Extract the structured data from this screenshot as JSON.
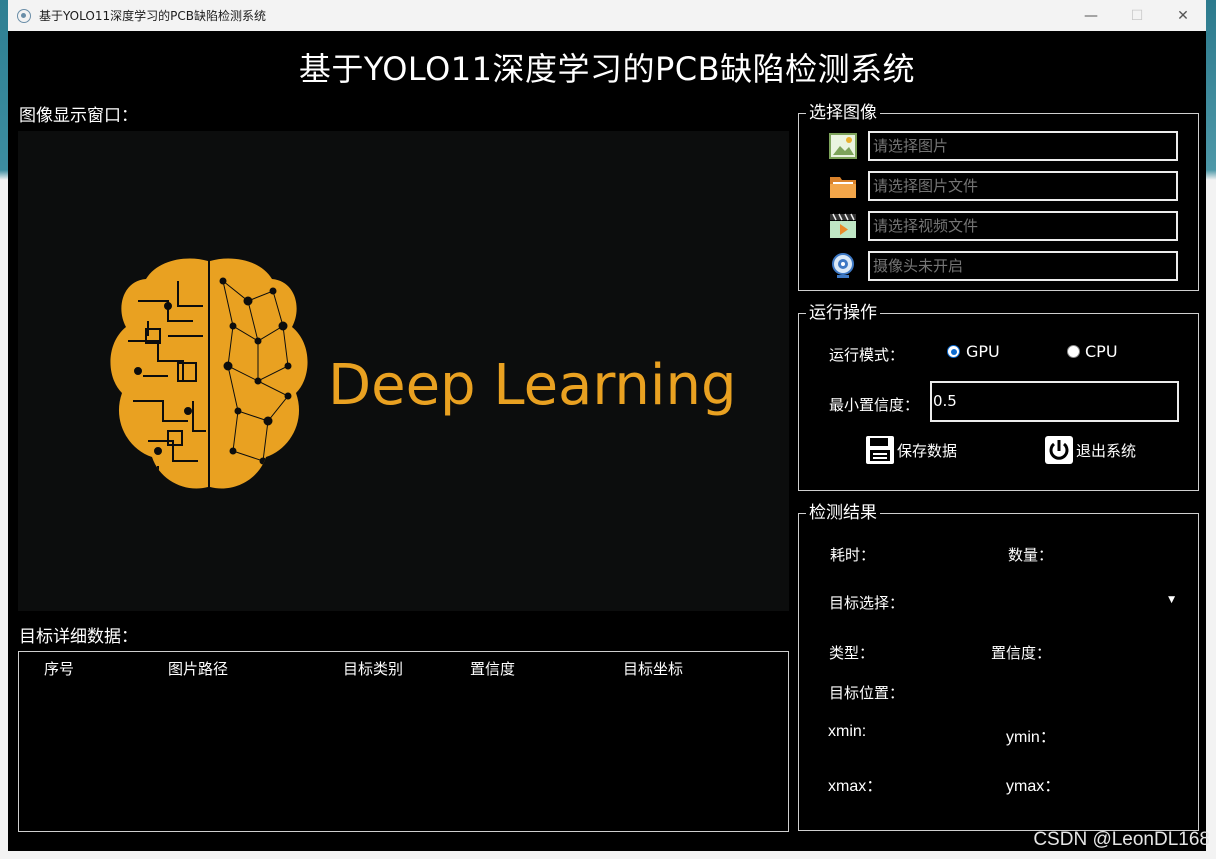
{
  "window": {
    "title": "基于YOLO11深度学习的PCB缺陷检测系统",
    "controls": {
      "minimize": "—",
      "maximize": "☐",
      "close": "✕"
    }
  },
  "header": {
    "app_title": "基于YOLO11深度学习的PCB缺陷检测系统"
  },
  "display": {
    "label": "图像显示窗口：",
    "banner_text": "Deep Learning",
    "accent_color": "#e9a121",
    "background_color": "#0c0d0d"
  },
  "details": {
    "label": "目标详细数据：",
    "columns": [
      "序号",
      "图片路径",
      "目标类别",
      "置信度",
      "目标坐标"
    ],
    "rows": []
  },
  "select_image": {
    "title": "选择图像",
    "items": [
      {
        "icon": "image-icon",
        "placeholder": "请选择图片"
      },
      {
        "icon": "folder-icon",
        "placeholder": "请选择图片文件"
      },
      {
        "icon": "video-icon",
        "placeholder": "请选择视频文件"
      },
      {
        "icon": "camera-icon",
        "placeholder": "摄像头未开启"
      }
    ]
  },
  "run_ops": {
    "title": "运行操作",
    "mode_label": "运行模式：",
    "mode_options": [
      "GPU",
      "CPU"
    ],
    "mode_selected": "GPU",
    "conf_label": "最小置信度：",
    "conf_value": "0.5",
    "save_label": "保存数据",
    "exit_label": "退出系统"
  },
  "results": {
    "title": "检测结果",
    "time_label": "耗时：",
    "count_label": "数量：",
    "target_select_label": "目标选择：",
    "type_label": "类型：",
    "confidence_label": "置信度：",
    "position_label": "目标位置：",
    "xmin_label": "xmin:",
    "ymin_label": "ymin：",
    "xmax_label": "xmax：",
    "ymax_label": "ymax："
  },
  "watermark": "CSDN @LeonDL168"
}
